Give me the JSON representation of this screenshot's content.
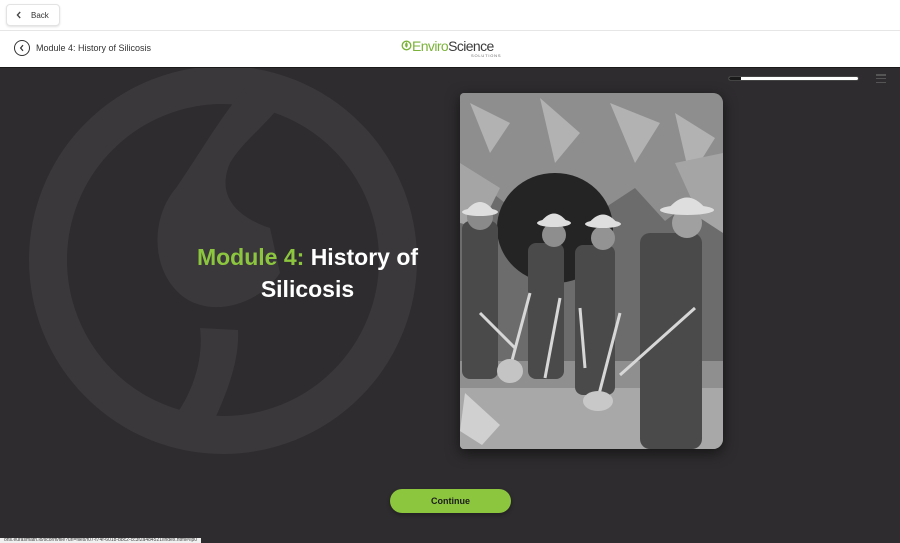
{
  "topbar": {
    "back_label": "Back"
  },
  "header": {
    "module_title": "Module 4: History of Silicosis",
    "logo_word1": "Enviro",
    "logo_word2": "Science",
    "logo_tagline": "SOLUTIONS",
    "progress_fraction": 0.09
  },
  "main": {
    "title_highlight": "Module 4:",
    "title_rest": "History of Silicosis",
    "continue_label": "Continue"
  },
  "status_bar": {
    "url": "ons.eurasmath.io/scorm/file?url=files/f07-f74f-6018-bbc2-cc3f2a484521/index.html#/lp0"
  },
  "colors": {
    "accent": "#8cc63f",
    "stage_bg": "#2e2c2e",
    "header_bg": "#ffffff"
  }
}
